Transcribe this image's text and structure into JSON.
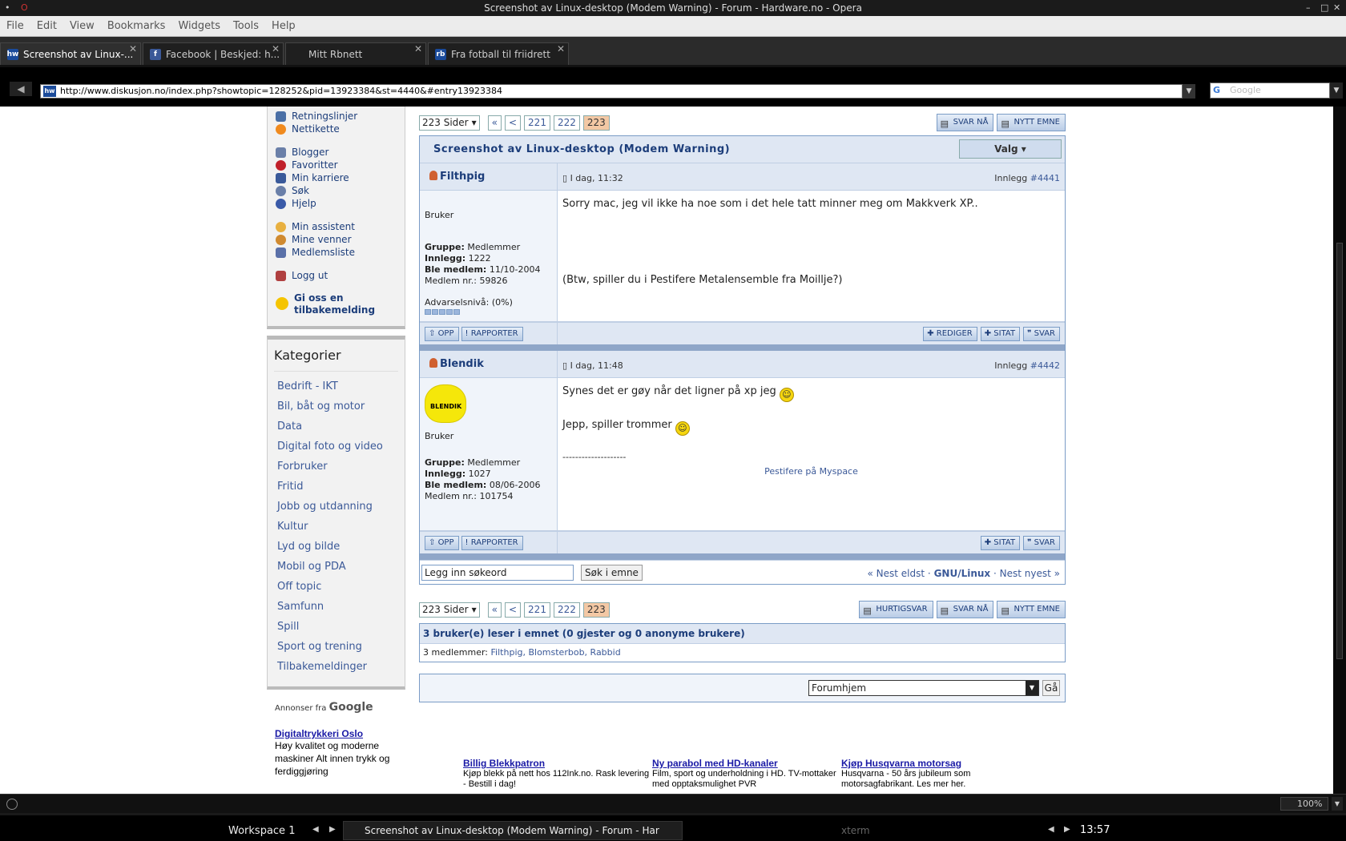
{
  "window": {
    "title": "Screenshot av Linux-desktop (Modem Warning) - Forum - Hardware.no - Opera"
  },
  "menu": [
    "File",
    "Edit",
    "View",
    "Bookmarks",
    "Widgets",
    "Tools",
    "Help"
  ],
  "tabs": [
    {
      "label": "Screenshot av Linux-...",
      "icon": "hw-icon",
      "color": "#1a4a9a"
    },
    {
      "label": "Facebook | Beskjed: h...",
      "icon": "facebook-icon",
      "color": "#3b5998"
    },
    {
      "label": "Mitt Rbnett",
      "icon": "",
      "color": ""
    },
    {
      "label": "Fra fotball til friidrett",
      "icon": "rb-icon",
      "color": "#1a4a9a"
    }
  ],
  "address": {
    "url": "http://www.diskusjon.no/index.php?showtopic=128252&pid=13923384&st=4440&#entry13923384",
    "search_placeholder": "Google"
  },
  "sidebar": {
    "links1": [
      {
        "label": "Retningslinjer",
        "color": "#4a6fa5"
      },
      {
        "label": "Nettikette",
        "color": "#f08a1e"
      }
    ],
    "links2": [
      {
        "label": "Blogger",
        "color": "#6a7fa8"
      },
      {
        "label": "Favoritter",
        "color": "#c0202a"
      },
      {
        "label": "Min karriere",
        "color": "#3a5a9a"
      },
      {
        "label": "Søk",
        "color": "#6a7fa8"
      },
      {
        "label": "Hjelp",
        "color": "#3a5aa8"
      }
    ],
    "links3": [
      {
        "label": "Min assistent",
        "color": "#e8b040"
      },
      {
        "label": "Mine venner",
        "color": "#d08a30"
      },
      {
        "label": "Medlemsliste",
        "color": "#5a70a8"
      }
    ],
    "logout": "Logg ut",
    "feedback": "Gi oss en tilbakemelding",
    "categories_title": "Kategorier",
    "categories": [
      "Bedrift - IKT",
      "Bil, båt og motor",
      "Data",
      "Digital foto og video",
      "Forbruker",
      "Fritid",
      "Jobb og utdanning",
      "Kultur",
      "Lyd og bilde",
      "Mobil og PDA",
      "Off topic",
      "Samfunn",
      "Spill",
      "Sport og trening",
      "Tilbakemeldinger"
    ],
    "ads_by": "Annonser fra",
    "ads_by_brand": "Google",
    "ad": {
      "title": "Digitaltrykkeri Oslo",
      "text": "Høy kvalitet og moderne maskiner Alt innen trykk og ferdiggjøring"
    }
  },
  "pager": {
    "select": "223 Sider",
    "first": "«",
    "prev": "<",
    "pages": [
      "221",
      "222",
      "223"
    ],
    "current": "223"
  },
  "actions_top": {
    "reply_now": "SVAR NÅ",
    "new_topic": "NYTT EMNE"
  },
  "actions_bottom": {
    "quick_reply": "HURTIGSVAR",
    "reply_now": "SVAR NÅ",
    "new_topic": "NYTT EMNE"
  },
  "topic": {
    "title": "Screenshot av Linux-desktop (Modem Warning)",
    "options": "Valg"
  },
  "posts": [
    {
      "author": "Filthpig",
      "date": "I dag, 11:32",
      "post_label": "Innlegg",
      "post_no": "#4441",
      "rank": "Bruker",
      "group_label": "Gruppe:",
      "group": "Medlemmer",
      "posts_label": "Innlegg:",
      "posts": "1222",
      "joined_label": "Ble medlem:",
      "joined": "11/10-2004",
      "member_no_label": "Medlem nr.:",
      "member_no": "59826",
      "warning": "Advarselsnivå: (0%)",
      "body1": "Sorry mac, jeg vil ikke ha noe som i det hele tatt minner meg om Makkverk XP..",
      "body2": "(Btw, spiller du i Pestifere Metalensemble fra Moillje?)"
    },
    {
      "author": "Blendik",
      "date": "I dag, 11:48",
      "post_label": "Innlegg",
      "post_no": "#4442",
      "avatar_text": "BLENDIK",
      "rank": "Bruker",
      "group_label": "Gruppe:",
      "group": "Medlemmer",
      "posts_label": "Innlegg:",
      "posts": "1027",
      "joined_label": "Ble medlem:",
      "joined": "08/06-2006",
      "member_no_label": "Medlem nr.:",
      "member_no": "101754",
      "body1": "Synes det er gøy når det ligner på xp jeg",
      "body2": "Jepp, spiller trommer",
      "sig_rule": "--------------------",
      "sig_link": "Pestifere på Myspace"
    }
  ],
  "post_buttons": {
    "up": "OPP",
    "report": "RAPPORTER",
    "edit": "REDIGER",
    "quote": "SITAT",
    "reply": "SVAR"
  },
  "search": {
    "placeholder": "Legg inn søkeord",
    "button": "Søk i emne"
  },
  "topicnav": {
    "older": "« Nest eldst",
    "forum": "GNU/Linux",
    "newer": "Nest nyest »",
    "sep": "·"
  },
  "readers": {
    "header": "3 bruker(e) leser i emnet (0 gjester og 0 anonyme brukere)",
    "members_label": "3 medlemmer:",
    "members": "Filthpig, Blomsterbob, Rabbid"
  },
  "jump": {
    "value": "Forumhjem",
    "go": "Gå"
  },
  "bottom_ads": [
    {
      "title": "Billig Blekkpatron",
      "text": "Kjøp blekk på nett hos 112Ink.no. Rask levering - Bestill i dag!"
    },
    {
      "title": "Ny parabol med HD-kanaler",
      "text": "Film, sport og underholdning i HD. TV-mottaker med opptaksmulighet PVR"
    },
    {
      "title": "Kjøp Husqvarna motorsag",
      "text": "Husqvarna - 50 års jubileum som motorsagfabrikant. Les mer her."
    }
  ],
  "status": {
    "zoom": "100%"
  },
  "taskbar": {
    "workspace": "Workspace 1",
    "task": "Screenshot av Linux-desktop (Modem Warning) - Forum - Har",
    "task2": "xterm",
    "clock": "13:57"
  }
}
